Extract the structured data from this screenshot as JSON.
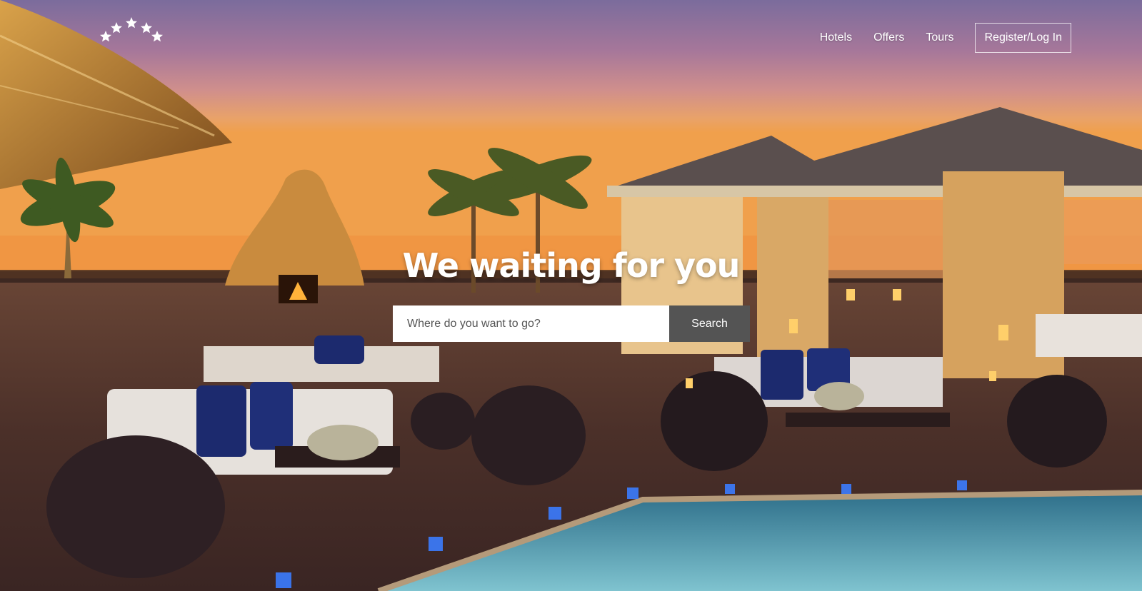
{
  "nav": {
    "logo_icon": "five-stars-icon",
    "links": [
      {
        "label": "Hotels"
      },
      {
        "label": "Offers"
      },
      {
        "label": "Tours"
      }
    ],
    "login_label": "Register/Log In"
  },
  "hero": {
    "headline": "We waiting for you",
    "search": {
      "placeholder": "Where do you want to go?",
      "value": "",
      "button_label": "Search"
    }
  },
  "colors": {
    "button_bg": "#545454",
    "text": "#ffffff"
  }
}
